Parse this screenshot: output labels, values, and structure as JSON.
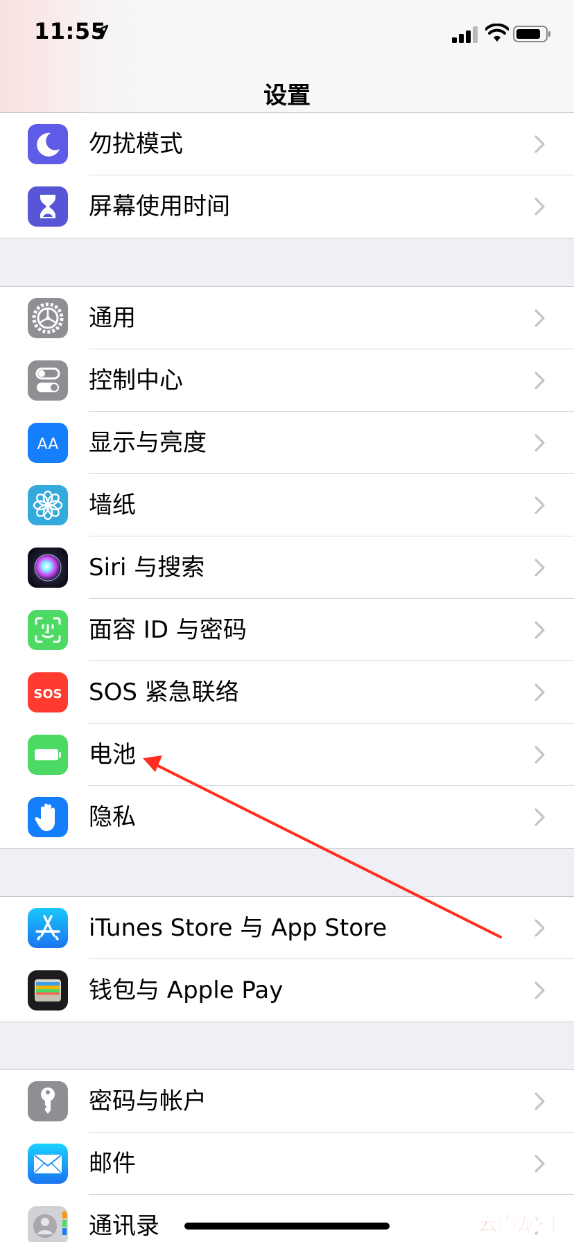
{
  "status_bar": {
    "time": "11:55",
    "location_icon": "location-arrow-icon",
    "signal_icon": "cellular-signal-icon",
    "wifi_icon": "wifi-icon",
    "battery_icon": "battery-icon"
  },
  "nav": {
    "title": "设置"
  },
  "groups": [
    {
      "items": [
        {
          "label": "勿扰模式",
          "icon": "moon-icon",
          "icon_color": "#5e5ce6"
        },
        {
          "label": "屏幕使用时间",
          "icon": "hourglass-icon",
          "icon_color": "#5856d6"
        }
      ]
    },
    {
      "items": [
        {
          "label": "通用",
          "icon": "gear-icon",
          "icon_color": "#8e8e93"
        },
        {
          "label": "控制中心",
          "icon": "toggles-icon",
          "icon_color": "#8e8e93"
        },
        {
          "label": "显示与亮度",
          "icon": "text-size-icon",
          "icon_color": "#147efb",
          "icon_text": "AA"
        },
        {
          "label": "墙纸",
          "icon": "flower-icon",
          "icon_color": "#34aadc"
        },
        {
          "label": "Siri 与搜索",
          "icon": "siri-icon",
          "icon_color": "#1c1c2e"
        },
        {
          "label": "面容 ID 与密码",
          "icon": "face-id-icon",
          "icon_color": "#4cd964"
        },
        {
          "label": "SOS 紧急联络",
          "icon": "sos-icon",
          "icon_color": "#ff3b30",
          "icon_text": "SOS"
        },
        {
          "label": "电池",
          "icon": "battery-setting-icon",
          "icon_color": "#4cd964"
        },
        {
          "label": "隐私",
          "icon": "hand-icon",
          "icon_color": "#147efb"
        }
      ]
    },
    {
      "items": [
        {
          "label": "iTunes Store 与 App Store",
          "icon": "app-store-icon",
          "icon_color": "#1a8cff"
        },
        {
          "label": "钱包与 Apple Pay",
          "icon": "wallet-icon",
          "icon_color": "#1c1c1e"
        }
      ]
    },
    {
      "items": [
        {
          "label": "密码与帐户",
          "icon": "key-icon",
          "icon_color": "#8e8e93"
        },
        {
          "label": "邮件",
          "icon": "mail-icon",
          "icon_color": "#1e90ff"
        },
        {
          "label": "通讯录",
          "icon": "contacts-icon",
          "icon_color": "#c7c7cc"
        }
      ]
    }
  ],
  "annotation": {
    "color": "#ff2d1f"
  },
  "watermark": {
    "text": "云南龙网"
  }
}
